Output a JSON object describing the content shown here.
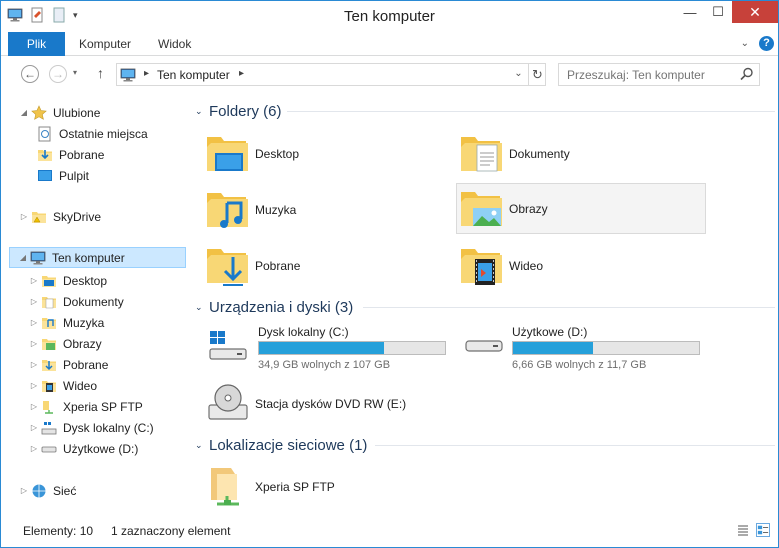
{
  "window": {
    "title": "Ten komputer"
  },
  "ribbon": {
    "tabs": [
      "Plik",
      "Komputer",
      "Widok"
    ]
  },
  "address": {
    "crumb": "Ten komputer"
  },
  "search": {
    "placeholder": "Przeszukaj: Ten komputer"
  },
  "nav": {
    "favorites": {
      "label": "Ulubione",
      "items": [
        "Ostatnie miejsca",
        "Pobrane",
        "Pulpit"
      ]
    },
    "skydrive": "SkyDrive",
    "computer": {
      "label": "Ten komputer",
      "items": [
        "Desktop",
        "Dokumenty",
        "Muzyka",
        "Obrazy",
        "Pobrane",
        "Wideo",
        "Xperia SP FTP",
        "Dysk lokalny (C:)",
        "Użytkowe (D:)"
      ]
    },
    "network": "Sieć"
  },
  "groups": {
    "folders": {
      "title": "Foldery (6)",
      "items": [
        "Desktop",
        "Dokumenty",
        "Muzyka",
        "Obrazy",
        "Pobrane",
        "Wideo"
      ]
    },
    "devices": {
      "title": "Urządzenia i dyski (3)",
      "drives": [
        {
          "name": "Dysk lokalny (C:)",
          "free_text": "34,9 GB wolnych z 107 GB",
          "used_fraction": 0.67
        },
        {
          "name": "Użytkowe (D:)",
          "free_text": "6,66 GB wolnych z 11,7 GB",
          "used_fraction": 0.43
        }
      ],
      "dvd": "Stacja dysków DVD RW (E:)"
    },
    "network": {
      "title": "Lokalizacje sieciowe (1)",
      "items": [
        "Xperia SP FTP"
      ]
    }
  },
  "status": {
    "count": "Elementy: 10",
    "selection": "1 zaznaczony element"
  },
  "colors": {
    "accent": "#1979ca",
    "progress": "#26a0da",
    "close": "#c7413a",
    "selection": "#cce8ff"
  }
}
